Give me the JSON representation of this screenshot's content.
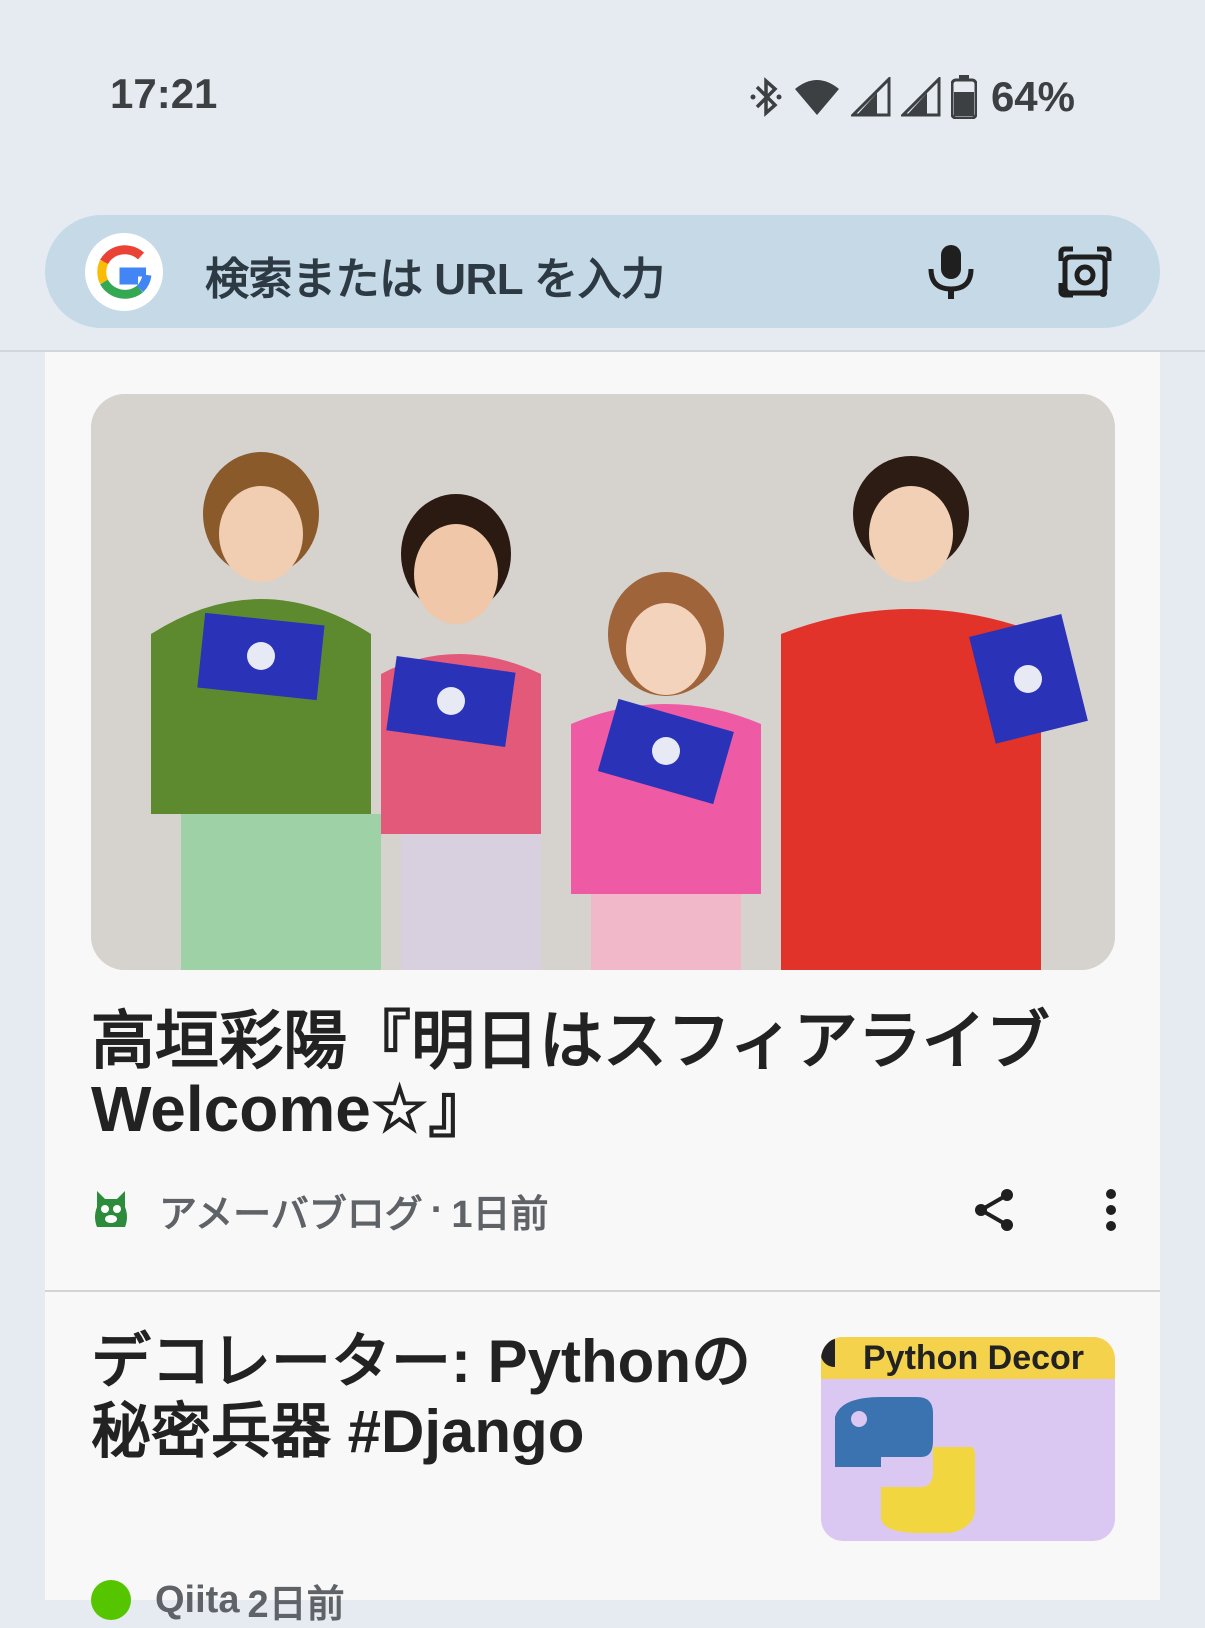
{
  "status_bar": {
    "time": "17:21",
    "battery_percent": "64%",
    "icons": [
      "bluetooth-icon",
      "wifi-icon",
      "signal-icon",
      "signal-icon",
      "battery-icon"
    ]
  },
  "search": {
    "placeholder": "検索または URL を入力",
    "icons": [
      "google-logo",
      "mic-icon",
      "lens-icon"
    ]
  },
  "feed": {
    "cards": [
      {
        "title": "高垣彩陽『明日はスフィアライブWelcome☆』",
        "source": "アメーバブログ",
        "separator": "·",
        "time": "1日前"
      },
      {
        "title": "デコレーター: Pythonの秘密兵器 #Django",
        "thumb_text": "Python Decor",
        "source": "Qiita",
        "time": "2日前"
      }
    ]
  },
  "colors": {
    "background": "#e5ebf1",
    "search_bar": "#c5d9e7",
    "card": "#f8f8f8",
    "text_primary": "#222222",
    "text_secondary": "#5f6368"
  }
}
